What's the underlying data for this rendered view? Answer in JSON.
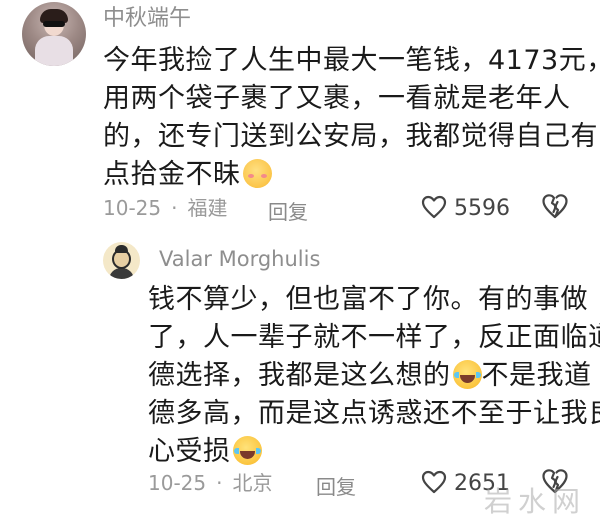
{
  "comments": [
    {
      "username": "中秋端午",
      "lines": [
        "今年我捡了人生中最大一笔钱，4173元，",
        "用两个袋子裹了又裹，一看就是老年人",
        "的，还专门送到公安局，我都觉得自己有",
        "点拾金不昧"
      ],
      "emoji": "shy-face-emoji",
      "date": "10-25",
      "location": "福建",
      "reply_label": "回复",
      "likes": "5596"
    },
    {
      "username": "Valar Morghulis",
      "lines": [
        "钱不算少，但也富不了你。有的事做",
        "了，人一辈子就不一样了，反正面临道",
        "德选择，我都是这么想的",
        "德多高，而是这点诱惑还不至于让我良",
        "心受损"
      ],
      "line3_tail": "不是我道",
      "emoji": "tears-of-joy-emoji",
      "date": "10-25",
      "location": "北京",
      "reply_label": "回复",
      "likes": "2651"
    }
  ],
  "separator": "·",
  "watermark": "岩水网",
  "colors": {
    "text": "#1a1a1a",
    "meta": "#9a9a9a",
    "username": "#8e8e8e"
  }
}
